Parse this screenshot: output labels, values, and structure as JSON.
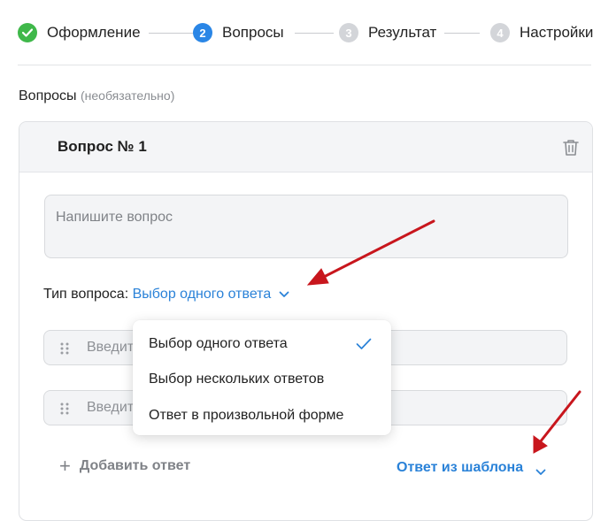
{
  "stepper": {
    "steps": [
      {
        "label": "Оформление",
        "number": "",
        "state": "done"
      },
      {
        "label": "Вопросы",
        "number": "2",
        "state": "active"
      },
      {
        "label": "Результат",
        "number": "3",
        "state": "todo"
      },
      {
        "label": "Настройки",
        "number": "4",
        "state": "todo"
      }
    ]
  },
  "section": {
    "title": "Вопросы",
    "optional": "(необязательно)"
  },
  "question_card": {
    "title": "Вопрос № 1",
    "question_placeholder": "Напишите вопрос",
    "type_label": "Тип вопроса:",
    "type_value": "Выбор одного ответа",
    "answers": [
      {
        "placeholder": "Введите ответ"
      },
      {
        "placeholder": "Введите ответ"
      }
    ],
    "add_answer": "Добавить ответ",
    "template": "Ответ из шаблона"
  },
  "type_dropdown": {
    "options": [
      "Выбор одного ответа",
      "Выбор нескольких ответов",
      "Ответ в произвольной форме"
    ],
    "selected_index": 0
  },
  "icons": {
    "done": "check-icon",
    "delete": "trash-icon",
    "drag": "drag-handle-icon",
    "chevron": "chevron-down-icon",
    "add": "plus-icon"
  },
  "colors": {
    "accent": "#2a82d8",
    "done": "#3fb84a",
    "active": "#2a86e6",
    "inactive": "#d3d5d9",
    "annotation_arrow": "#c8161d"
  }
}
